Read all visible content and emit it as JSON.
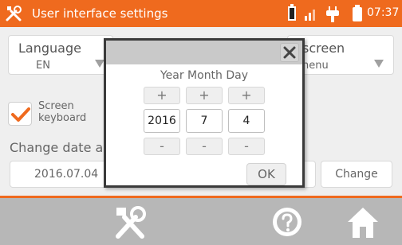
{
  "header": {
    "title": "User interface settings",
    "time": "07:37"
  },
  "language": {
    "label": "Language",
    "value": "EN"
  },
  "screen_setting": {
    "label": "screen",
    "value": "nenu"
  },
  "screen_keyboard": {
    "label_line1": "Screen",
    "label_line2": "keyboard",
    "checked": true
  },
  "date_section": {
    "title": "Change date ar",
    "current_date": "2016.07.04",
    "change_label": "Change"
  },
  "dialog": {
    "title": "Year Month Day",
    "plus_label": "+",
    "minus_label": "-",
    "year": "2016",
    "month": "7",
    "day": "4",
    "ok_label": "OK"
  },
  "colors": {
    "accent": "#ef6a1e",
    "footer": "#b7b7b7"
  },
  "icons": [
    "tools-icon",
    "battery-icon",
    "signal-icon",
    "plug-icon",
    "close-icon",
    "help-icon",
    "home-icon",
    "check-icon"
  ]
}
